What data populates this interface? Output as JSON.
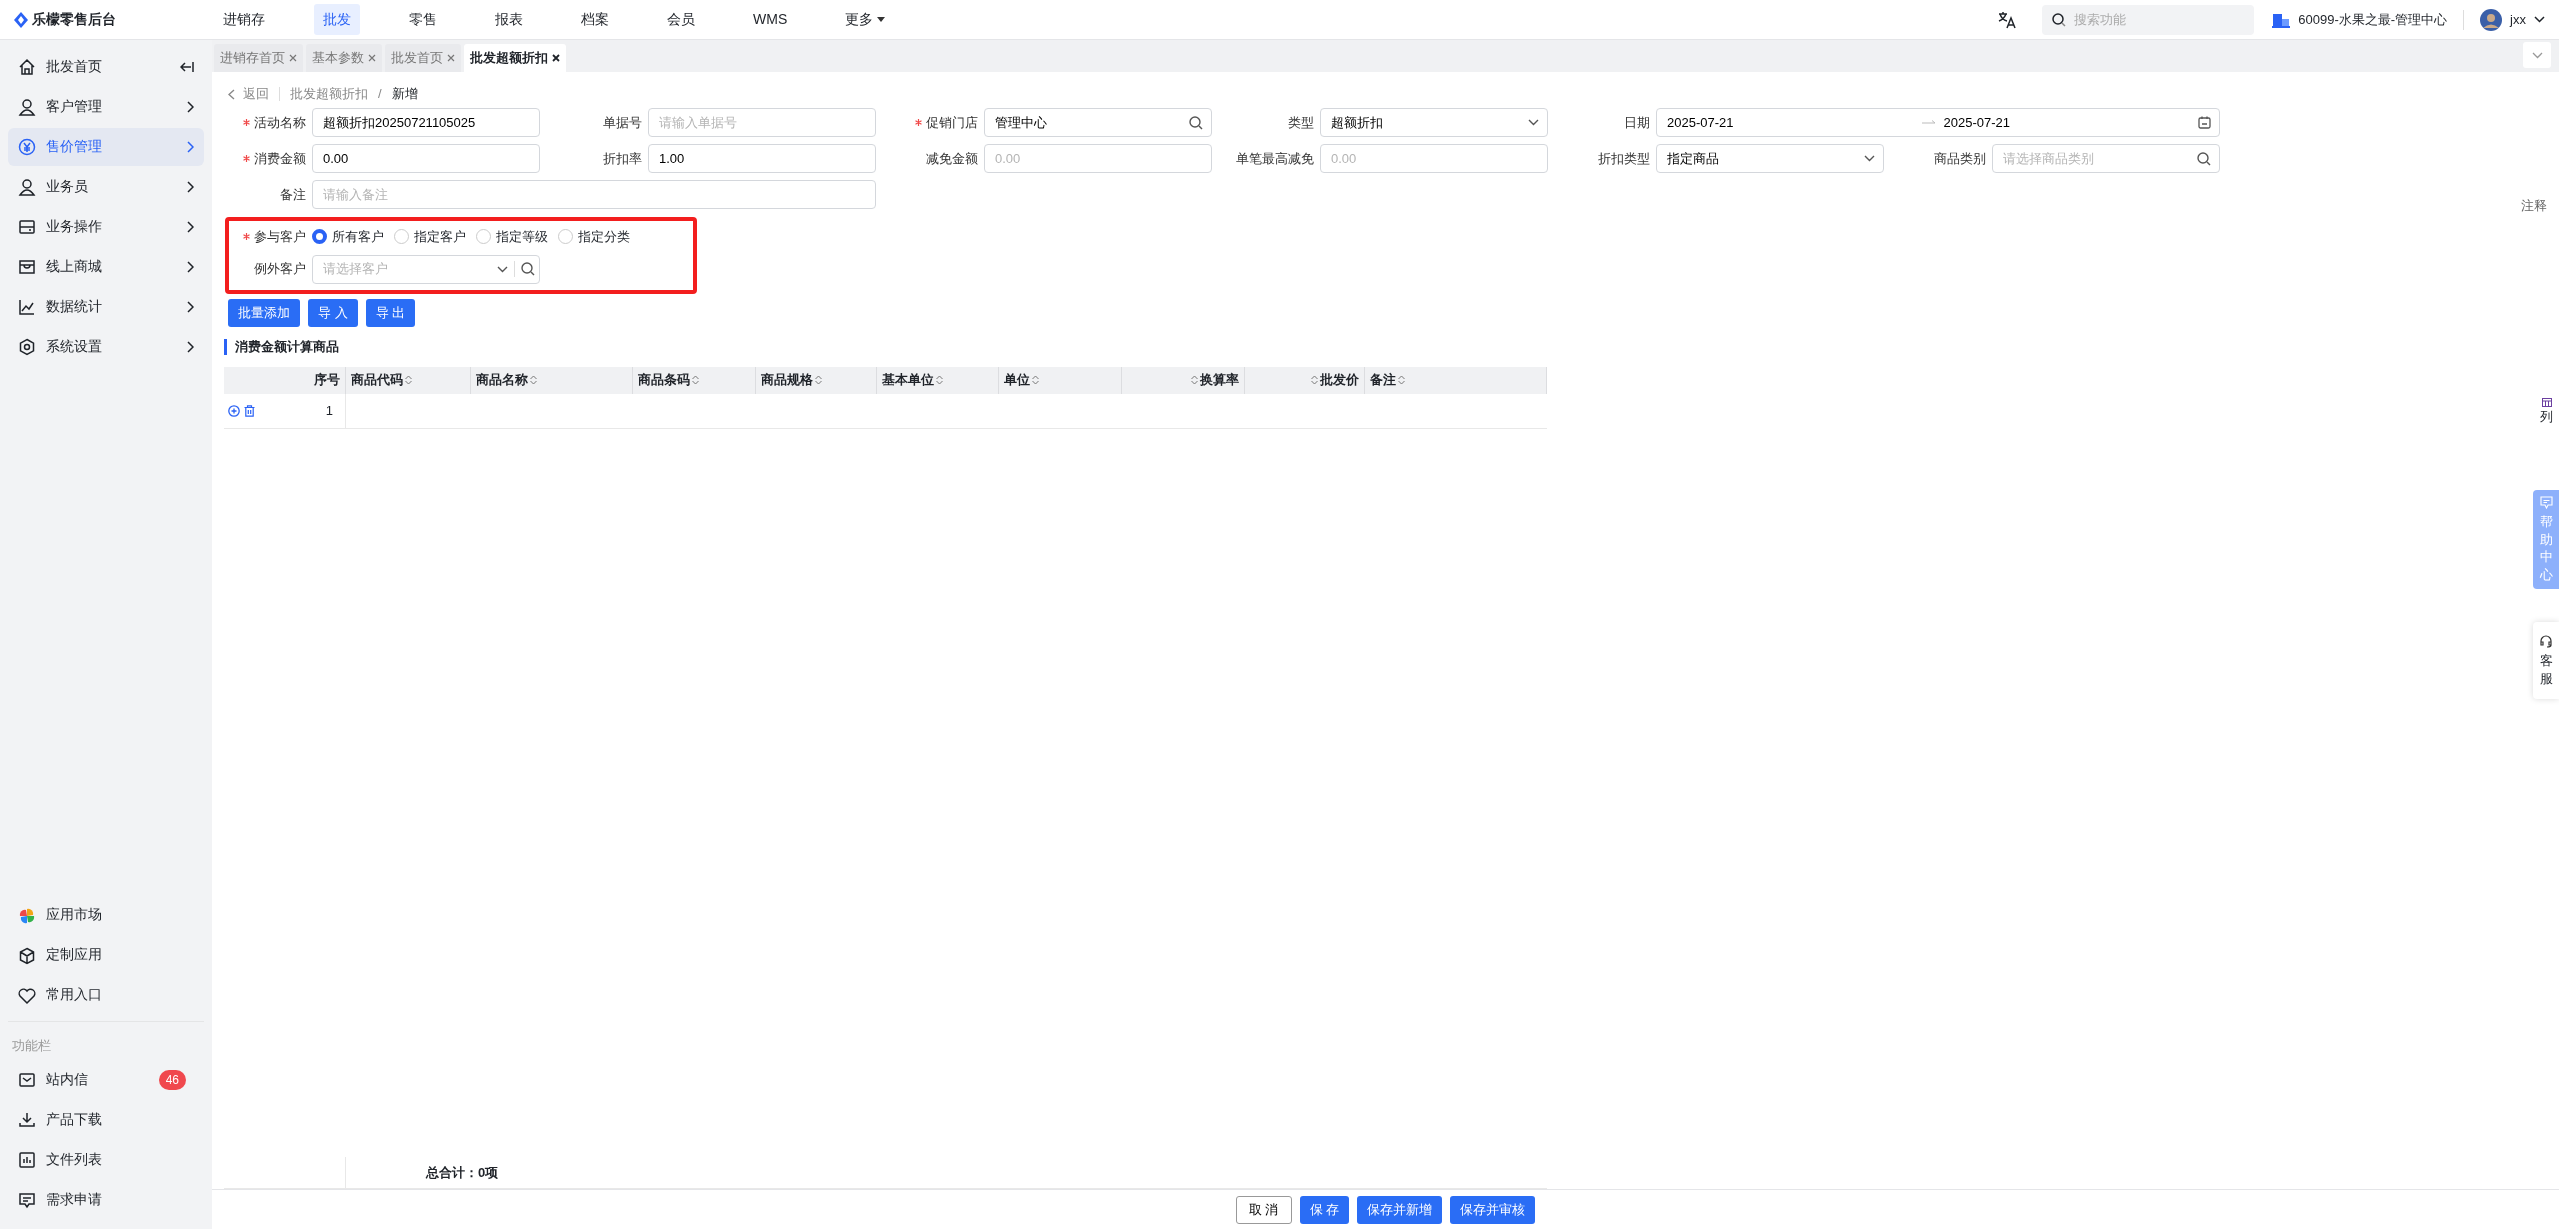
{
  "topbar": {
    "logo": "乐檬零售后台",
    "nav": [
      {
        "label": "进销存",
        "selected": false
      },
      {
        "label": "批发",
        "selected": true
      },
      {
        "label": "零售",
        "selected": false
      },
      {
        "label": "报表",
        "selected": false
      },
      {
        "label": "档案",
        "selected": false
      },
      {
        "label": "会员",
        "selected": false
      },
      {
        "label": "WMS",
        "selected": false
      }
    ],
    "more": "更多",
    "search": {
      "placeholder": "搜索功能"
    },
    "store": "60099-水果之最-管理中心",
    "user": "jxx"
  },
  "sidebar": {
    "items": [
      {
        "label": "批发首页",
        "selected": false,
        "kind": "collapse"
      },
      {
        "label": "客户管理",
        "selected": false,
        "kind": "group"
      },
      {
        "label": "售价管理",
        "selected": true,
        "kind": "group"
      },
      {
        "label": "业务员",
        "selected": false,
        "kind": "group"
      },
      {
        "label": "业务操作",
        "selected": false,
        "kind": "group"
      },
      {
        "label": "线上商城",
        "selected": false,
        "kind": "group"
      },
      {
        "label": "数据统计",
        "selected": false,
        "kind": "group"
      },
      {
        "label": "系统设置",
        "selected": false,
        "kind": "group"
      }
    ],
    "apps": [
      "应用市场",
      "定制应用",
      "常用入口"
    ],
    "tools_title": "功能栏",
    "tools": [
      {
        "label": "站内信",
        "badge": "46"
      },
      {
        "label": "产品下载"
      },
      {
        "label": "文件列表"
      },
      {
        "label": "需求申请"
      }
    ]
  },
  "tabs": [
    {
      "label": "进销存首页",
      "selected": false
    },
    {
      "label": "基本参数",
      "selected": false
    },
    {
      "label": "批发首页",
      "selected": false
    },
    {
      "label": "批发超额折扣",
      "selected": true
    }
  ],
  "breadcrumb": {
    "back": "返回",
    "parent": "批发超额折扣",
    "separator": "/",
    "current": "新增"
  },
  "form": [
    {
      "label": "活动名称",
      "required": true,
      "kind": "text",
      "value": "超额折扣20250721105025"
    },
    {
      "label": "单据号",
      "required": false,
      "kind": "text",
      "placeholder": "请输入单据号"
    },
    {
      "label": "促销门店",
      "required": true,
      "kind": "search",
      "value": "管理中心"
    },
    {
      "label": "类型",
      "required": false,
      "kind": "select",
      "value": "超额折扣"
    },
    {
      "label": "日期",
      "required": false,
      "kind": "date-range",
      "value": "2025-07-21",
      "value_end": "2025-07-21"
    },
    {
      "label": "消费金额",
      "required": true,
      "kind": "text",
      "value": "0.00"
    },
    {
      "label": "折扣率",
      "required": false,
      "kind": "text",
      "value": "1.00"
    },
    {
      "label": "减免金额",
      "required": false,
      "kind": "text",
      "placeholder": "0.00"
    },
    {
      "label": "单笔最高减免",
      "required": false,
      "kind": "text",
      "placeholder": "0.00"
    },
    {
      "label": "折扣类型",
      "required": false,
      "kind": "select",
      "value": "指定商品"
    },
    {
      "label": "商品类别",
      "required": false,
      "kind": "search",
      "placeholder": "请选择商品类别"
    },
    {
      "label": "备注",
      "required": false,
      "kind": "wide-text",
      "placeholder": "请输入备注"
    }
  ],
  "customers": {
    "highlighted": true,
    "label": "参与客户",
    "required": true,
    "options": [
      {
        "label": "所有客户",
        "selected": true
      },
      {
        "label": "指定客户",
        "selected": false
      },
      {
        "label": "指定等级",
        "selected": false
      },
      {
        "label": "指定分类",
        "selected": false
      }
    ],
    "exclude": {
      "label": "例外客户",
      "placeholder": "请选择客户"
    }
  },
  "actions": [
    "批量添加",
    "导 入",
    "导 出"
  ],
  "notes_link": "注释",
  "section_title": "消费金额计算商品",
  "table": {
    "columns": [
      {
        "label": "序号",
        "sortable": false,
        "kind": "index"
      },
      {
        "label": "商品代码",
        "sortable": true,
        "kind": "text"
      },
      {
        "label": "商品名称",
        "sortable": true,
        "kind": "text"
      },
      {
        "label": "商品条码",
        "sortable": true,
        "kind": "text"
      },
      {
        "label": "商品规格",
        "sortable": true,
        "kind": "text"
      },
      {
        "label": "基本单位",
        "sortable": true,
        "kind": "text"
      },
      {
        "label": "单位",
        "sortable": true,
        "kind": "text"
      },
      {
        "label": "换算率",
        "sortable": true,
        "kind": "numeric"
      },
      {
        "label": "批发价",
        "sortable": true,
        "kind": "numeric"
      },
      {
        "label": "备注",
        "sortable": true,
        "kind": "text"
      }
    ],
    "rows": [
      {
        "index": "1"
      }
    ],
    "total": "总合计：0项"
  },
  "side_tabs": {
    "columns": "列",
    "help": "帮助中心",
    "service": "客服"
  },
  "footer_buttons": [
    {
      "label": "取 消",
      "primary": false
    },
    {
      "label": "保 存",
      "primary": true
    },
    {
      "label": "保存并新增",
      "primary": true
    },
    {
      "label": "保存并审核",
      "primary": true
    }
  ]
}
